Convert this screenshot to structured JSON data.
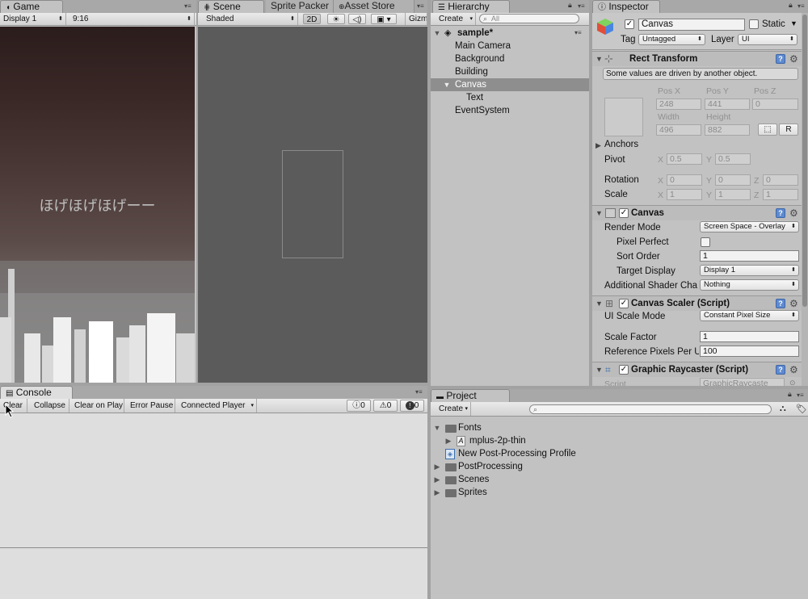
{
  "game": {
    "tab_label": "Game",
    "display": "Display 1",
    "aspect": "9:16",
    "text": "ほげほげほげーー"
  },
  "scene": {
    "tab_label": "Scene",
    "shading": "Shaded",
    "mode_2d": "2D",
    "gizmos": "Gizm"
  },
  "sprite_packer": {
    "tab_label": "Sprite Packer"
  },
  "asset_store": {
    "tab_label": "Asset Store"
  },
  "hierarchy": {
    "tab_label": "Hierarchy",
    "create": "Create",
    "search_placeholder": "All",
    "scene_name": "sample*",
    "items": [
      {
        "label": "Main Camera"
      },
      {
        "label": "Background"
      },
      {
        "label": "Building"
      },
      {
        "label": "Canvas"
      },
      {
        "label": "Text"
      },
      {
        "label": "EventSystem"
      }
    ]
  },
  "inspector": {
    "tab_label": "Inspector",
    "object_name": "Canvas",
    "static_label": "Static",
    "tag_label": "Tag",
    "tag_value": "Untagged",
    "layer_label": "Layer",
    "layer_value": "UI",
    "rect_transform": {
      "title": "Rect Transform",
      "notice": "Some values are driven by another object.",
      "pos_x_label": "Pos X",
      "pos_y_label": "Pos Y",
      "pos_z_label": "Pos Z",
      "pos_x": "248",
      "pos_y": "441",
      "pos_z": "0",
      "width_label": "Width",
      "height_label": "Height",
      "width": "496",
      "height": "882",
      "r_label": "R",
      "anchors_label": "Anchors",
      "pivot_label": "Pivot",
      "pivot_x": "0.5",
      "pivot_y": "0.5",
      "rotation_label": "Rotation",
      "rot_x": "0",
      "rot_y": "0",
      "rot_z": "0",
      "scale_label": "Scale",
      "scale_x": "1",
      "scale_y": "1",
      "scale_z": "1",
      "x": "X",
      "y": "Y",
      "z": "Z"
    },
    "canvas": {
      "title": "Canvas",
      "render_mode_label": "Render Mode",
      "render_mode": "Screen Space - Overlay",
      "pixel_perfect_label": "Pixel Perfect",
      "sort_order_label": "Sort Order",
      "sort_order": "1",
      "target_display_label": "Target Display",
      "target_display": "Display 1",
      "shader_channels_label": "Additional Shader Cha",
      "shader_channels": "Nothing"
    },
    "canvas_scaler": {
      "title": "Canvas Scaler (Script)",
      "ui_scale_mode_label": "UI Scale Mode",
      "ui_scale_mode": "Constant Pixel Size",
      "scale_factor_label": "Scale Factor",
      "scale_factor": "1",
      "ref_ppu_label": "Reference Pixels Per U",
      "ref_ppu": "100"
    },
    "graphic_raycaster": {
      "title": "Graphic Raycaster (Script)",
      "script_label": "Script",
      "script_value": "GraphicRaycaste"
    }
  },
  "console": {
    "tab_label": "Console",
    "clear": "Clear",
    "collapse": "Collapse",
    "clear_on_play": "Clear on Play",
    "error_pause": "Error Pause",
    "connected_player": "Connected Player",
    "info_count": "0",
    "warn_count": "0",
    "error_count": "0"
  },
  "project": {
    "tab_label": "Project",
    "create": "Create",
    "items": [
      {
        "label": "Fonts"
      },
      {
        "label": "mplus-2p-thin"
      },
      {
        "label": "New Post-Processing Profile"
      },
      {
        "label": "PostProcessing"
      },
      {
        "label": "Scenes"
      },
      {
        "label": "Sprites"
      }
    ]
  },
  "colors": {
    "accent_blue": "#5e8ad0",
    "selection": "#8e8e8e",
    "panel_bg": "#c2c2c2",
    "game_sky_top": "#2b1d1c",
    "game_sky_bottom": "#6e6663"
  }
}
